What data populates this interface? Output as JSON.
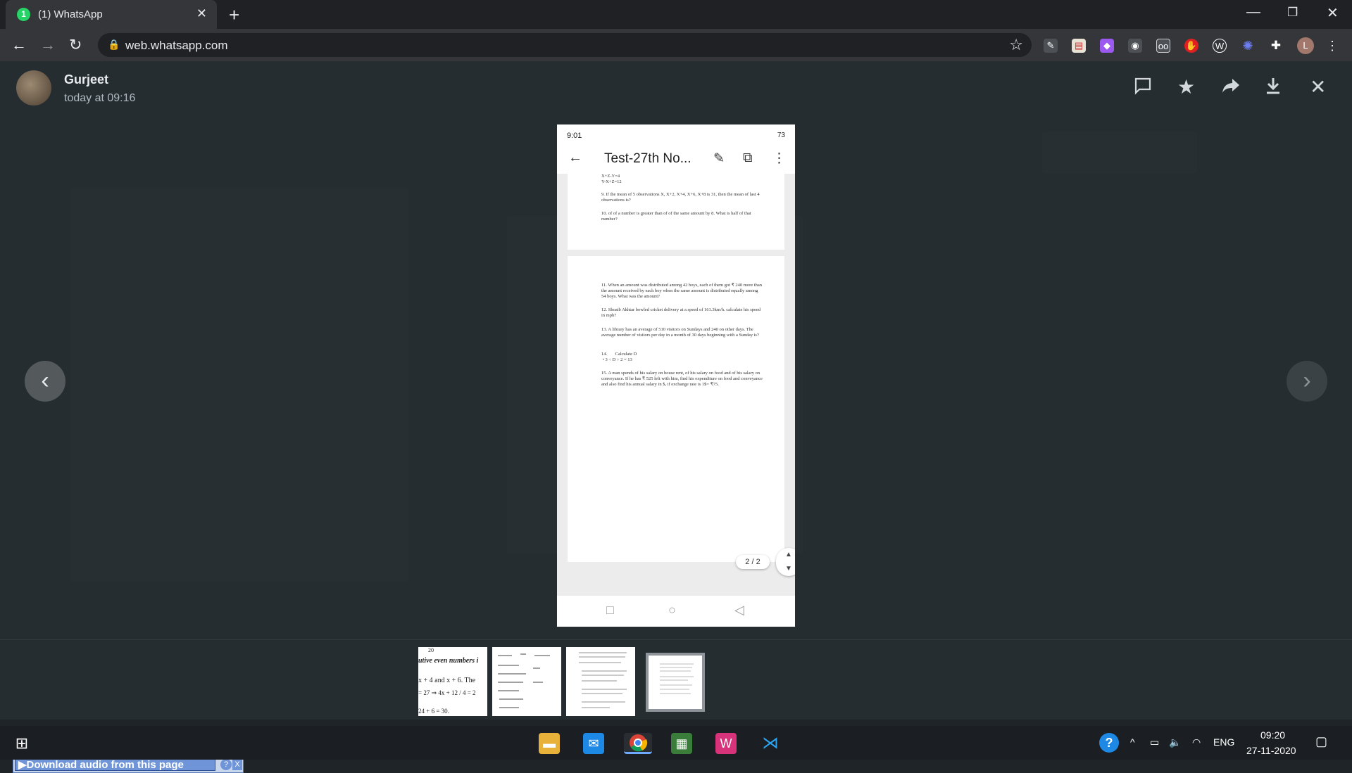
{
  "browser": {
    "tab_title": "(1) WhatsApp",
    "tab_favicon": "1",
    "url": "web.whatsapp.com",
    "profile_initial": "L"
  },
  "viewer": {
    "sender_name": "Gurjeet",
    "sender_time": "today at 09:16"
  },
  "phone": {
    "status_time": "9:01",
    "status_right": "73",
    "doc_title": "Test-27th No...",
    "page_indicator": "2 / 2",
    "questions_top": [
      "X+Z-Y=4",
      "Y-X+Z=12",
      "9.  If the mean of 5 observations X, X+2, X+4, X+6, X+8 is 31, then the mean of last 4 observations is?",
      "10.       of of a number is greater than  of of the same amount by 8. What is half of that number?"
    ],
    "questions_bottom": [
      "11.       When an amount was distributed among 42 boys, each of them got ₹ 240 more than the amount received by each boy when the same amount is distributed equally among 54 boys. What was the amount?",
      "12.       Shoaib Akhtar bowled cricket delivery at a speed of 161.3km/h. calculate his speed in mph?",
      "13.       A library has an average of 510 visitors on Sundays and 240 on other days. The average number of visitors per day in a month of 30 days beginning with a Sunday is?",
      "14.       Calculate D\n • 3 ÷ D ÷ 2 = 13",
      "15.       A man spends  of his salary on house rent,  of his salary on food and  of his salary on conveyance. If he has ₹ 525 left with him, find his expenditure on food and conveyance and also find his annual salary in $, if exchange rate is 1$= ₹75."
    ]
  },
  "thumbs": {
    "t1_lines": [
      "20",
      "utive even numbers i",
      "x + 4 and x + 6. The",
      "= 27  ⇒  4x + 12 / 4  = 2",
      "24 + 6 = 30."
    ]
  },
  "download_bar": {
    "label": "Download audio from this page",
    "help": "?",
    "close": "X"
  },
  "taskbar": {
    "lang": "ENG",
    "time": "09:20",
    "date": "27-11-2020"
  },
  "colors": {
    "whatsapp_green": "#25d366",
    "viewer_bg": "#262d31",
    "taskbar_bg": "#1b1e22"
  }
}
